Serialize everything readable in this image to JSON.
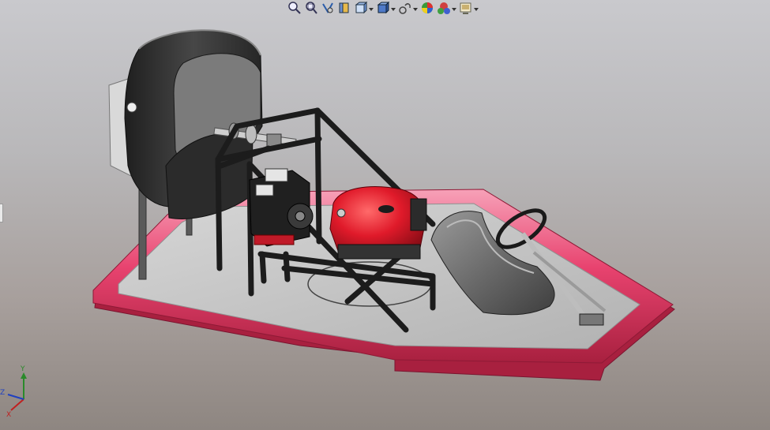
{
  "toolbar": {
    "buttons": [
      {
        "icon": "zoom-to-fit-icon",
        "dropdown": false
      },
      {
        "icon": "zoom-to-area-icon",
        "dropdown": false
      },
      {
        "icon": "previous-view-icon",
        "dropdown": false
      },
      {
        "icon": "section-view-icon",
        "dropdown": false
      },
      {
        "icon": "view-orientation-icon",
        "dropdown": true
      },
      {
        "icon": "display-style-icon",
        "dropdown": true
      },
      {
        "icon": "hide-show-items-icon",
        "dropdown": true
      },
      {
        "icon": "edit-appearance-icon",
        "dropdown": false
      },
      {
        "icon": "apply-scene-icon",
        "dropdown": true
      },
      {
        "icon": "view-settings-icon",
        "dropdown": true
      }
    ]
  },
  "triad": {
    "x_label": "X",
    "y_label": "Y",
    "z_label": "Z"
  },
  "colors": {
    "hull_pink": "#e8436f",
    "deck": "#c4c4c4",
    "frame": "#2a2a2a",
    "engine_red": "#e01a2a",
    "fan_duct": "#3a3a3a",
    "seat": "#6a6a6a"
  }
}
